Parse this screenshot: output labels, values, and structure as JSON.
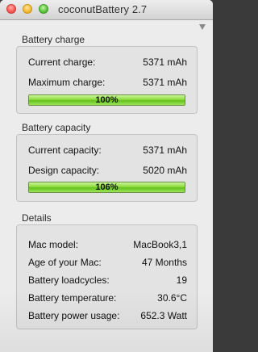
{
  "window": {
    "title": "coconutBattery 2.7"
  },
  "charge": {
    "section_title": "Battery charge",
    "current_label": "Current charge:",
    "current_value": "5371 mAh",
    "maximum_label": "Maximum charge:",
    "maximum_value": "5371 mAh",
    "percent_text": "100%",
    "percent": 100
  },
  "capacity": {
    "section_title": "Battery capacity",
    "current_label": "Current capacity:",
    "current_value": "5371 mAh",
    "design_label": "Design capacity:",
    "design_value": "5020 mAh",
    "percent_text": "106%",
    "percent": 106
  },
  "details": {
    "section_title": "Details",
    "rows": [
      {
        "label": "Mac model:",
        "value": "MacBook3,1"
      },
      {
        "label": "Age of your Mac:",
        "value": "47 Months"
      },
      {
        "label": "Battery loadcycles:",
        "value": "19"
      },
      {
        "label": "Battery temperature:",
        "value": "30.6°C"
      },
      {
        "label": "Battery power usage:",
        "value": "652.3 Watt"
      }
    ]
  },
  "colors": {
    "bar_fill": "#8fdc3e",
    "panel_bg": "#e3e3e3",
    "window_bg": "#ececec"
  }
}
